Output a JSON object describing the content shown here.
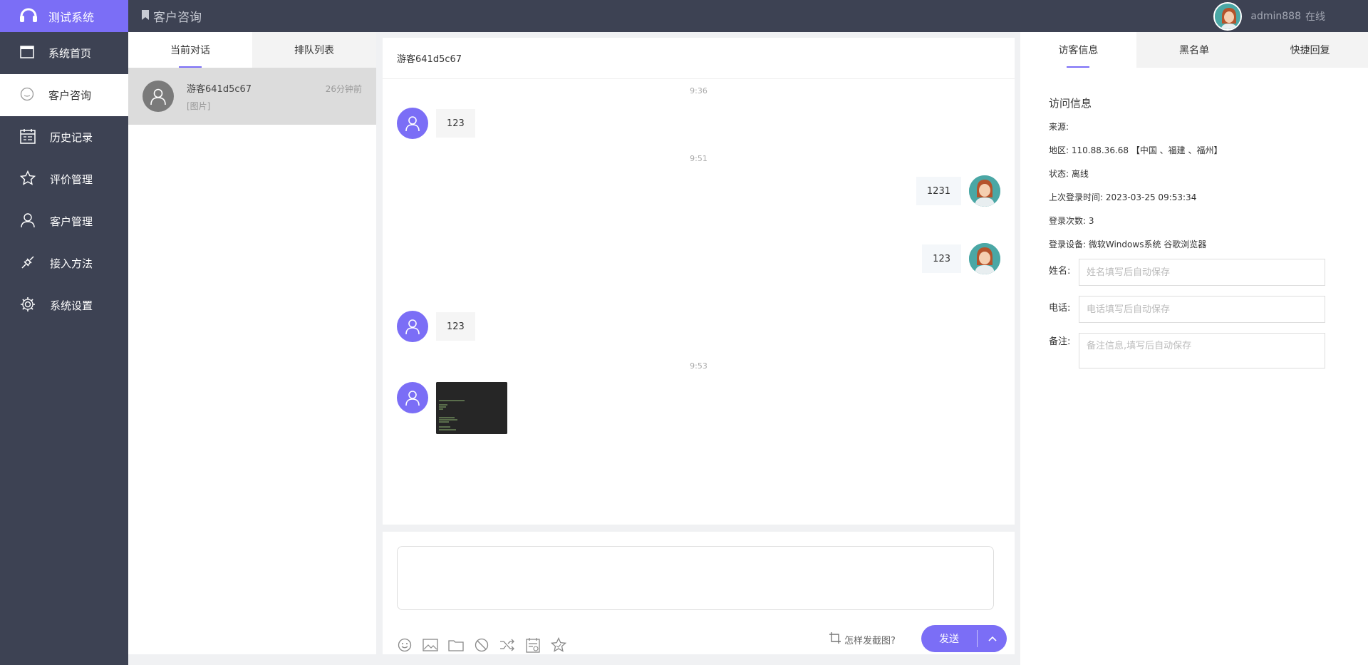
{
  "brand": {
    "name": "测试系统",
    "icon": "headset-icon"
  },
  "header": {
    "page_title": "客户咨询",
    "user_name": "admin888",
    "user_status": "在线"
  },
  "sidebar": {
    "items": [
      {
        "label": "系统首页",
        "icon": "window-icon",
        "active": false
      },
      {
        "label": "客户咨询",
        "icon": "chat-bubble-icon",
        "active": true
      },
      {
        "label": "历史记录",
        "icon": "calendar-icon",
        "active": false
      },
      {
        "label": "评价管理",
        "icon": "star-icon",
        "active": false
      },
      {
        "label": "客户管理",
        "icon": "user-icon",
        "active": false
      },
      {
        "label": "接入方法",
        "icon": "plug-icon",
        "active": false
      },
      {
        "label": "系统设置",
        "icon": "gear-icon",
        "active": false
      }
    ]
  },
  "conversations": {
    "tabs": [
      "当前对话",
      "排队列表"
    ],
    "items": [
      {
        "name": "游客641d5c67",
        "last_message": "[图片]",
        "time": "26分钟前"
      }
    ]
  },
  "chat": {
    "visitor_name": "游客641d5c67",
    "times": [
      "9:36",
      "9:51",
      "9:53"
    ],
    "messages": [
      {
        "from": "visitor",
        "text": "123"
      },
      {
        "from": "agent",
        "text": "1231"
      },
      {
        "from": "agent",
        "text": "123"
      },
      {
        "from": "visitor",
        "text": "123"
      },
      {
        "from": "visitor",
        "type": "image"
      }
    ]
  },
  "editor": {
    "screenshot_tip": "怎样发截图?",
    "send_label": "发送",
    "tools": [
      "emoji-icon",
      "image-icon",
      "folder-icon",
      "block-icon",
      "transfer-icon",
      "calendar-note-icon",
      "star-outline-icon"
    ]
  },
  "info_panel": {
    "tabs": [
      "访客信息",
      "黑名单",
      "快捷回复"
    ],
    "title": "访问信息",
    "rows": {
      "source_label": "来源:",
      "source_value": "",
      "region_label": "地区:",
      "region_value": "110.88.36.68 【中国 、福建 、福州】",
      "status_label": "状态:",
      "status_value": "离线",
      "last_login_label": "上次登录时间:",
      "last_login_value": "2023-03-25 09:53:34",
      "login_count_label": "登录次数:",
      "login_count_value": "3",
      "device_label": "登录设备:",
      "device_value": "微软Windows系统 谷歌浏览器"
    },
    "form": {
      "name_label": "姓名:",
      "name_placeholder": "姓名填写后自动保存",
      "phone_label": "电话:",
      "phone_placeholder": "电话填写后自动保存",
      "note_label": "备注:",
      "note_placeholder": "备注信息,填写后自动保存"
    }
  },
  "colors": {
    "accent": "#7b6ef6",
    "sidebar_bg": "#3d4253"
  }
}
